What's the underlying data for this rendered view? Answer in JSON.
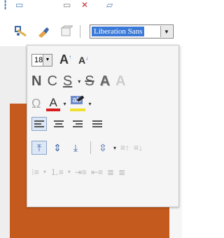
{
  "toolbar": {
    "font_name": "Liberation Sans"
  },
  "panel": {
    "font_size": "18",
    "grow_font": "A",
    "shrink_font": "A",
    "format": {
      "bold": "N",
      "italic": "C",
      "underline": "S",
      "strike": "S",
      "shadow": "A",
      "outline": "A"
    },
    "special_char": "Ω",
    "font_color_letter": "A",
    "highlight_letter": "ab"
  },
  "colors": {
    "font_color": "#d81e1e",
    "highlight": "#f0e02a",
    "slide": "#c55a1e",
    "selection": "#3b7ad8"
  }
}
